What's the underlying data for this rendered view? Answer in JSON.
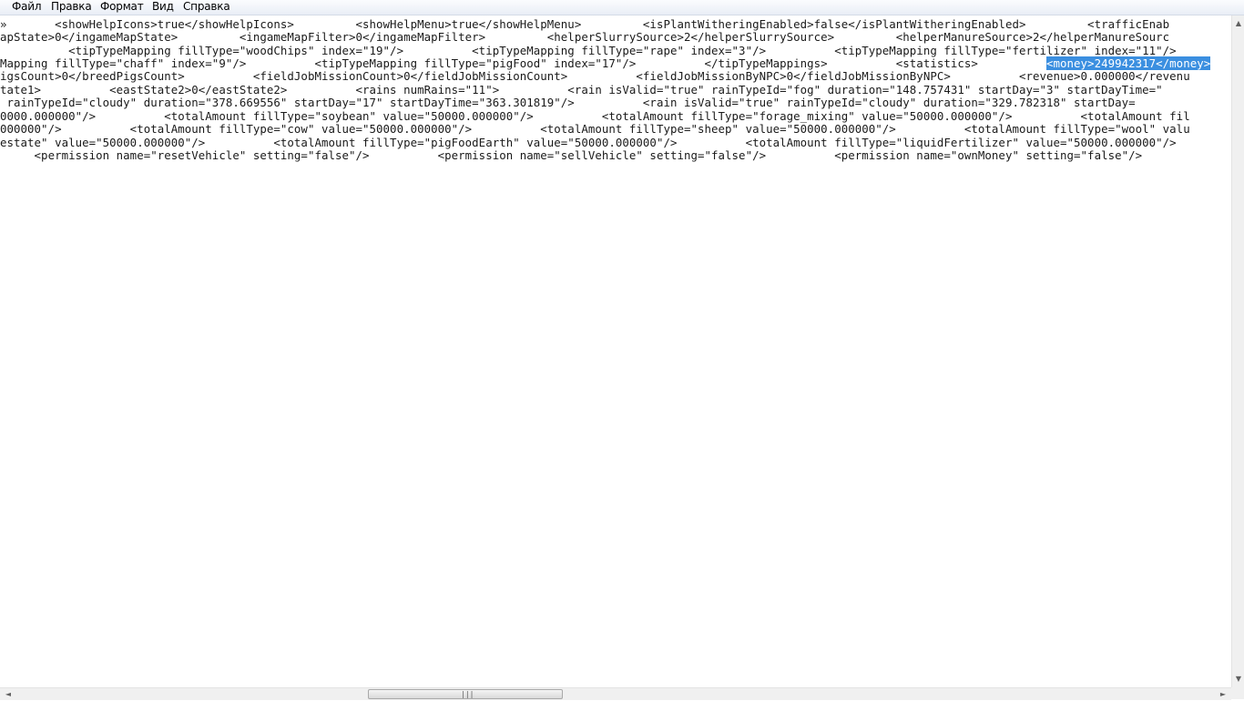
{
  "menu": {
    "file": "Файл",
    "edit": "Правка",
    "format": "Формат",
    "view": "Вид",
    "help": "Справка"
  },
  "editor": {
    "lines": [
      "»       <showHelpIcons>true</showHelpIcons>         <showHelpMenu>true</showHelpMenu>         <isPlantWitheringEnabled>false</isPlantWitheringEnabled>         <trafficEnab",
      "apState>0</ingameMapState>         <ingameMapFilter>0</ingameMapFilter>         <helperSlurrySource>2</helperSlurrySource>         <helperManureSource>2</helperManureSourc",
      "          <tipTypeMapping fillType=\"woodChips\" index=\"19\"/>          <tipTypeMapping fillType=\"rape\" index=\"3\"/>          <tipTypeMapping fillType=\"fertilizer\" index=\"11\"/>",
      "Mapping fillType=\"chaff\" index=\"9\"/>          <tipTypeMapping fillType=\"pigFood\" index=\"17\"/>          </tipTypeMappings>          <statistics>          ",
      "igsCount>0</breedPigsCount>          <fieldJobMissionCount>0</fieldJobMissionCount>          <fieldJobMissionByNPC>0</fieldJobMissionByNPC>          <revenue>0.000000</revenu",
      "tate1>          <eastState2>0</eastState2>          <rains numRains=\"11\">          <rain isValid=\"true\" rainTypeId=\"fog\" duration=\"148.757431\" startDay=\"3\" startDayTime=\"",
      " rainTypeId=\"cloudy\" duration=\"378.669556\" startDay=\"17\" startDayTime=\"363.301819\"/>          <rain isValid=\"true\" rainTypeId=\"cloudy\" duration=\"329.782318\" startDay=",
      "0000.000000\"/>          <totalAmount fillType=\"soybean\" value=\"50000.000000\"/>          <totalAmount fillType=\"forage_mixing\" value=\"50000.000000\"/>          <totalAmount fil",
      "000000\"/>          <totalAmount fillType=\"cow\" value=\"50000.000000\"/>          <totalAmount fillType=\"sheep\" value=\"50000.000000\"/>          <totalAmount fillType=\"wool\" valu",
      "estate\" value=\"50000.000000\"/>          <totalAmount fillType=\"pigFoodEarth\" value=\"50000.000000\"/>          <totalAmount fillType=\"liquidFertilizer\" value=\"50000.000000\"/>",
      "     <permission name=\"resetVehicle\" setting=\"false\"/>          <permission name=\"sellVehicle\" setting=\"false\"/>          <permission name=\"ownMoney\" setting=\"false\"/>"
    ],
    "selected_text": "<money>249942317</money>"
  },
  "scrollbars": {
    "up_arrow": "▲",
    "down_arrow": "▼",
    "left_arrow": "◄",
    "right_arrow": "►",
    "grip": "|||"
  }
}
